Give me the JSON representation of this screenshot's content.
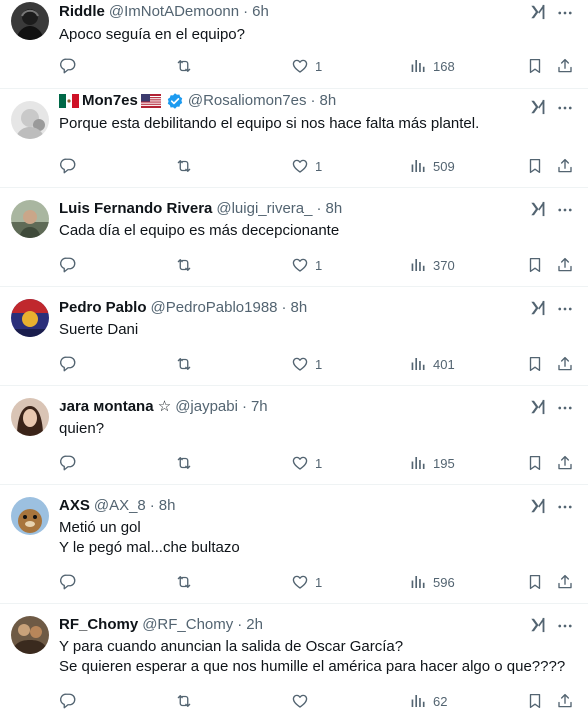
{
  "replies": [
    {
      "name": "Riddle",
      "handle": "@ImNotADemoonn",
      "time": "6h",
      "text": "Apoco seguía en el equipo?",
      "likes": "1",
      "views": "168",
      "avatar_color": "#2c2c2c"
    },
    {
      "name": "Mon7es",
      "handle": "@Rosaliomon7es",
      "time": "8h",
      "text": "Porque esta debilitando el equipo si nos hace falta más plantel.",
      "likes": "1",
      "views": "509",
      "verified": true,
      "avatar_color": "#e3e3e3"
    },
    {
      "name": "Luis Fernando Rivera",
      "handle": "@luigi_rivera_",
      "time": "8h",
      "text": "Cada día el equipo es más decepcionante",
      "likes": "1",
      "views": "370",
      "avatar_color": "#7e8a74"
    },
    {
      "name": "Pedro Pablo",
      "handle": "@PedroPablo1988",
      "time": "8h",
      "text": "Suerte Dani",
      "likes": "1",
      "views": "401",
      "avatar_color": "#2b2f7a"
    },
    {
      "name": "ᴊara ᴍontana ☆",
      "handle": "@jaypabi",
      "time": "7h",
      "text": "quien?",
      "likes": "1",
      "views": "195",
      "avatar_color": "#b99a86"
    },
    {
      "name": "AXS",
      "handle": "@AX_8",
      "time": "8h",
      "text": "Metió un gol\nY le pegó mal...che bultazo",
      "likes": "1",
      "views": "596",
      "avatar_color": "#6d8fb5"
    },
    {
      "name": "RF_Chomy",
      "handle": "@RF_Chomy",
      "time": "2h",
      "text": "Y para cuando anuncian la salida de Oscar García?\nSe quieren esperar a que nos humille el américa para hacer algo o que????",
      "likes": "",
      "views": "62",
      "avatar_color": "#5a4030"
    }
  ],
  "separator": "·",
  "icons": {
    "reply": "reply-icon",
    "retweet": "retweet-icon",
    "like": "heart-icon",
    "views": "views-icon",
    "bookmark": "bookmark-icon",
    "share": "share-icon",
    "grok": "grok-icon",
    "more": "more-icon"
  },
  "colors": {
    "text": "#0f1419",
    "muted": "#536471",
    "verified": "#1d9bf0",
    "divider": "#eff3f4"
  }
}
